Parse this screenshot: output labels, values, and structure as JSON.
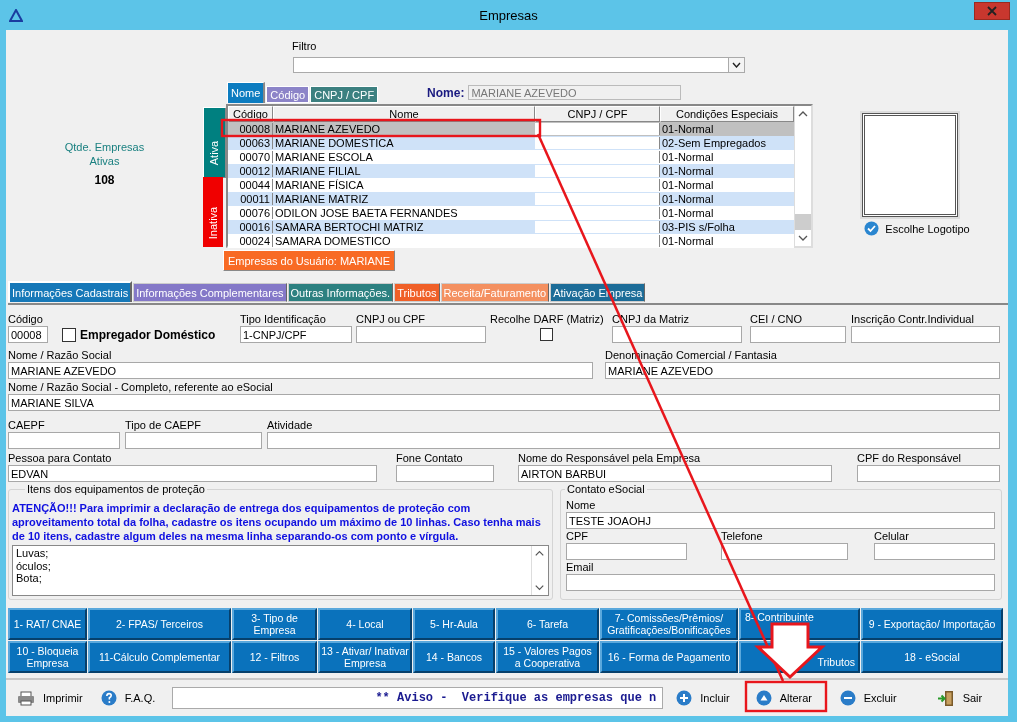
{
  "window": {
    "title": "Empresas"
  },
  "summary": {
    "label": "Qtde. Empresas Ativas",
    "count": "108"
  },
  "filter": {
    "label": "Filtro"
  },
  "search_tabs": [
    {
      "label": "Nome",
      "selected": true,
      "color": "#0c7cc0"
    },
    {
      "label": "Código",
      "selected": false,
      "color": "#8c84c8"
    },
    {
      "label": "CNPJ / CPF",
      "selected": false,
      "color": "#3c8080"
    }
  ],
  "search": {
    "label": "Nome:",
    "value": "MARIANE AZEVEDO"
  },
  "status_tabs": [
    {
      "label": "Ativa",
      "selected": true,
      "color": "#008080"
    },
    {
      "label": "Inativa",
      "selected": false,
      "color": "#f00000"
    }
  ],
  "table": {
    "columns": [
      "Código",
      "Nome",
      "CNPJ / CPF",
      "Condições Especiais"
    ],
    "rows": [
      {
        "code": "00008",
        "name": "MARIANE AZEVEDO",
        "condition": "01-Normal",
        "selected": true
      },
      {
        "code": "00063",
        "name": "MARIANE DOMESTICA",
        "condition": "02-Sem Empregados",
        "selected": false
      },
      {
        "code": "00070",
        "name": "MARIANE ESCOLA",
        "condition": "01-Normal",
        "selected": false
      },
      {
        "code": "00012",
        "name": "MARIANE FILIAL",
        "condition": "01-Normal",
        "selected": false
      },
      {
        "code": "00044",
        "name": "MARIANE FÍSICA",
        "condition": "01-Normal",
        "selected": false
      },
      {
        "code": "00011",
        "name": "MARIANE MATRIZ",
        "condition": "01-Normal",
        "selected": false
      },
      {
        "code": "00076",
        "name": "ODILON JOSE BAETA FERNANDES",
        "condition": "01-Normal",
        "selected": false
      },
      {
        "code": "00016",
        "name": "SAMARA BERTOCHI  MATRIZ",
        "condition": "03-PIS s/Folha",
        "selected": false
      },
      {
        "code": "00024",
        "name": "SAMARA DOMESTICO",
        "condition": "01-Normal",
        "selected": false
      }
    ]
  },
  "user_button": "Empresas do Usuário: MARIANE",
  "logo": {
    "label": "Escolhe Logotipo"
  },
  "form_tabs": [
    {
      "label": "Informações Cadastrais",
      "selected": true,
      "color": "#1678b8"
    },
    {
      "label": "Informações Complementares",
      "selected": false,
      "color": "#8478c8"
    },
    {
      "label": "Outras Informações.",
      "selected": false,
      "color": "#2c8080"
    },
    {
      "label": "Tributos",
      "selected": false,
      "color": "#f06028"
    },
    {
      "label": "Receita/Faturamento",
      "selected": false,
      "color": "#f49060"
    },
    {
      "label": "Ativação Empresa",
      "selected": false,
      "color": "#1c6c98"
    }
  ],
  "form": {
    "lines": [
      {
        "fields": [
          {
            "kind": "text",
            "label": "Código",
            "value": "00008"
          },
          {
            "kind": "check-inline",
            "label": "Empregador Doméstico",
            "checked": false
          },
          {
            "kind": "text",
            "label": "Tipo Identificação",
            "value": "1-CNPJ/CPF"
          },
          {
            "kind": "text",
            "label": "CNPJ ou CPF"
          },
          {
            "kind": "check-stacked",
            "label": "Recolhe DARF (Matriz)",
            "checked": false
          },
          {
            "kind": "text",
            "label": "CNPJ da Matriz"
          },
          {
            "kind": "text",
            "label": "CEI / CNO"
          },
          {
            "kind": "text",
            "label": "Inscrição Contr.Individual"
          }
        ]
      },
      {
        "fields": [
          {
            "kind": "text",
            "label": "Nome / Razão Social",
            "value": "MARIANE AZEVEDO"
          },
          {
            "kind": "text",
            "label": "Denominação Comercial / Fantasia",
            "value": "MARIANE AZEVEDO"
          }
        ]
      },
      {
        "fields": [
          {
            "kind": "text",
            "label": "Nome / Razão Social - Completo, referente ao eSocial",
            "value": "MARIANE SILVA"
          }
        ]
      },
      {
        "fields": [
          {
            "kind": "text",
            "label": "CAEPF"
          },
          {
            "kind": "text",
            "label": "Tipo de CAEPF"
          },
          {
            "kind": "text",
            "label": "Atividade"
          }
        ]
      },
      {
        "fields": [
          {
            "kind": "text",
            "label": "Pessoa para Contato",
            "value": "EDVAN"
          },
          {
            "kind": "text",
            "label": "Fone Contato"
          },
          {
            "kind": "text",
            "label": "Nome do Responsável pela Empresa",
            "value": "AIRTON BARBUI"
          },
          {
            "kind": "text",
            "label": "CPF do Responsável"
          }
        ]
      }
    ]
  },
  "equipment": {
    "title": "Itens dos equipamentos de proteção",
    "notice": "ATENÇÃO!!! Para imprimir a declaração de entrega dos equipamentos de proteção com aproveitamento total da folha, cadastre os itens ocupando um máximo de 10 linhas. Caso tenha mais de 10 itens, cadastre algum deles na mesma linha separando-os com ponto e vírgula.",
    "items": [
      "Luvas;",
      "óculos;",
      "Bota;"
    ]
  },
  "esocial": {
    "title": "Contato eSocial",
    "fields": [
      {
        "label": "Nome",
        "value": "TESTE JOAOHJ"
      },
      {
        "label": "CPF"
      },
      {
        "label": "Telefone"
      },
      {
        "label": "Celular"
      },
      {
        "label": "Email"
      }
    ]
  },
  "function_buttons": [
    [
      "1- RAT/ CNAE",
      "2- FPAS/ Terceiros",
      "3- Tipo de Empresa",
      "4- Local",
      "5- Hr-Aula",
      "6- Tarefa",
      "7- Comissões/Prêmios/ Gratificações/Bonificações",
      "8- Contribuinte",
      "9 - Exportação/ Importação"
    ],
    [
      "10 - Bloqueia Empresa",
      "11-Cálculo Complementar",
      "12 - Filtros",
      "13 - Ativar/ Inativar Empresa",
      "14 - Bancos",
      "15 - Valores Pagos a Cooperativa",
      "16 - Forma de Pagamento",
      "Tributos",
      "18 - eSocial"
    ]
  ],
  "toolbar": [
    {
      "kind": "print",
      "label": "Imprimir"
    },
    {
      "kind": "help",
      "label": "F.A.Q."
    },
    {
      "kind": "ticker",
      "label": "** Aviso -  Verifique as empresas que n"
    },
    {
      "kind": "add",
      "label": "Incluir"
    },
    {
      "kind": "edit",
      "label": "Alterar"
    },
    {
      "kind": "delete",
      "label": "Excluir"
    },
    {
      "kind": "exit",
      "label": "Sair"
    }
  ],
  "annotations": [
    {
      "kind": "box"
    },
    {
      "kind": "line"
    },
    {
      "kind": "box"
    },
    {
      "kind": "arrow"
    }
  ]
}
